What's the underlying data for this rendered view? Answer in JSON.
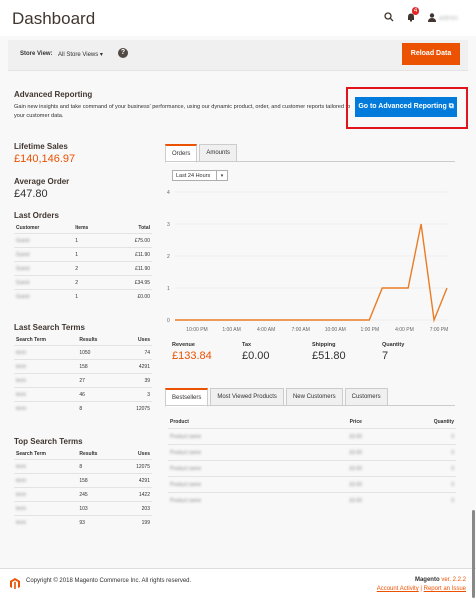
{
  "header": {
    "title": "Dashboard",
    "notification_count": "4",
    "user_name": "admin"
  },
  "storebar": {
    "label": "Store View:",
    "selected": "All Store Views",
    "reload_label": "Reload Data"
  },
  "advanced": {
    "title": "Advanced Reporting",
    "text": "Gain new insights and take command of your business' performance, using our dynamic product, order, and customer reports tailored to your customer data.",
    "button": "Go to Advanced Reporting"
  },
  "stats": {
    "lifetime_label": "Lifetime Sales",
    "lifetime_value": "£140,146.97",
    "average_label": "Average Order",
    "average_value": "£47.80"
  },
  "last_orders": {
    "title": "Last Orders",
    "headers": [
      "Customer",
      "Items",
      "Total"
    ],
    "rows": [
      {
        "customer": "Guest",
        "items": "1",
        "total": "£75.00"
      },
      {
        "customer": "Guest",
        "items": "1",
        "total": "£11.90"
      },
      {
        "customer": "Guest",
        "items": "2",
        "total": "£11.90"
      },
      {
        "customer": "Guest",
        "items": "2",
        "total": "£34.95"
      },
      {
        "customer": "Guest",
        "items": "1",
        "total": "£0.00"
      }
    ]
  },
  "last_search": {
    "title": "Last Search Terms",
    "headers": [
      "Search Term",
      "Results",
      "Uses"
    ],
    "rows": [
      {
        "term": "term",
        "results": "1050",
        "uses": "74"
      },
      {
        "term": "term",
        "results": "158",
        "uses": "4291"
      },
      {
        "term": "term",
        "results": "27",
        "uses": "39"
      },
      {
        "term": "term",
        "results": "46",
        "uses": "3"
      },
      {
        "term": "term",
        "results": "8",
        "uses": "12075"
      }
    ]
  },
  "top_search": {
    "title": "Top Search Terms",
    "headers": [
      "Search Term",
      "Results",
      "Uses"
    ],
    "rows": [
      {
        "term": "term",
        "results": "8",
        "uses": "12075"
      },
      {
        "term": "term",
        "results": "158",
        "uses": "4291"
      },
      {
        "term": "term",
        "results": "245",
        "uses": "1422"
      },
      {
        "term": "term",
        "results": "103",
        "uses": "203"
      },
      {
        "term": "term",
        "results": "93",
        "uses": "199"
      }
    ]
  },
  "chart_tabs": [
    "Orders",
    "Amounts"
  ],
  "range": "Last 24 Hours",
  "chart_data": {
    "type": "line",
    "x": [
      "10:00 PM",
      "1:00 AM",
      "4:00 AM",
      "7:00 AM",
      "10:00 AM",
      "1:00 PM",
      "4:00 PM",
      "7:00 PM"
    ],
    "series": [
      {
        "values": [
          0,
          0,
          0,
          0,
          0,
          0,
          0,
          0,
          0,
          0,
          0,
          0,
          0,
          0,
          0,
          0,
          1,
          1,
          1,
          3,
          0,
          1
        ]
      }
    ],
    "ylim": [
      0,
      4
    ],
    "yticks": [
      "0",
      "1",
      "2",
      "3",
      "4"
    ],
    "color": "#eb7c25"
  },
  "totals": [
    {
      "label": "Revenue",
      "value": "£133.84"
    },
    {
      "label": "Tax",
      "value": "£0.00"
    },
    {
      "label": "Shipping",
      "value": "£51.80"
    },
    {
      "label": "Quantity",
      "value": "7"
    }
  ],
  "product_tabs": [
    "Bestsellers",
    "Most Viewed Products",
    "New Customers",
    "Customers"
  ],
  "products": {
    "headers": [
      "Product",
      "Price",
      "Quantity"
    ],
    "rows": [
      {
        "name": "Product name",
        "price": "£0.00",
        "qty": "0"
      },
      {
        "name": "Product name",
        "price": "£0.00",
        "qty": "0"
      },
      {
        "name": "Product name",
        "price": "£0.00",
        "qty": "0"
      },
      {
        "name": "Product name",
        "price": "£0.00",
        "qty": "0"
      },
      {
        "name": "Product name",
        "price": "£0.00",
        "qty": "0"
      }
    ]
  },
  "footer": {
    "copyright": "Copyright © 2018 Magento Commerce Inc. All rights reserved.",
    "brand": "Magento",
    "version": "ver. 2.2.2",
    "link1": "Account Activity",
    "sep": "|",
    "link2": "Report an Issue"
  }
}
